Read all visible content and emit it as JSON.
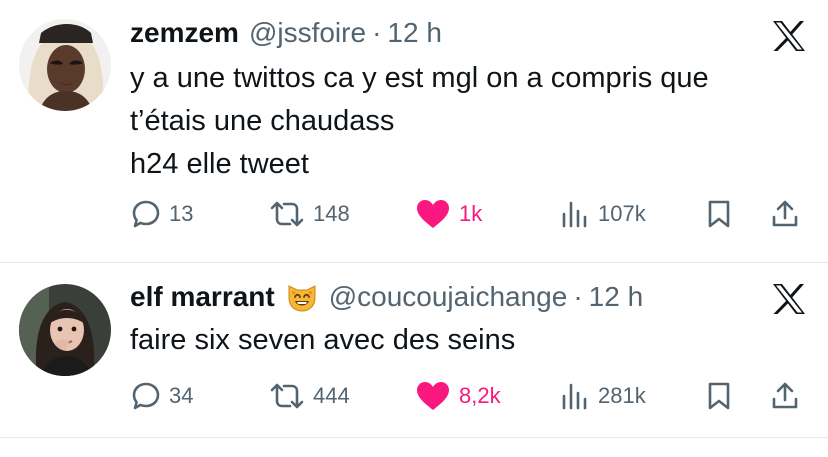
{
  "colors": {
    "like": "#f91880",
    "muted": "#536471",
    "text": "#0f1419"
  },
  "tweets": [
    {
      "name": "zemzem",
      "handle": "@jssfoire",
      "separator": "·",
      "time": "12 h",
      "body": [
        "y a une twittos ca y est mgl on a compris que",
        "t’étais une chaudass",
        "h24 elle tweet"
      ],
      "replies": "13",
      "retweets": "148",
      "likes": "1k",
      "views": "107k",
      "liked": true
    },
    {
      "name": "elf marrant",
      "emoji": "smiling-cat-emoji",
      "handle": "@coucoujaichange",
      "separator": "·",
      "time": "12 h",
      "body": [
        "faire six seven avec des seins"
      ],
      "replies": "34",
      "retweets": "444",
      "likes": "8,2k",
      "views": "281k",
      "liked": true
    }
  ],
  "icons": [
    "x-logo-icon",
    "reply-icon",
    "retweet-icon",
    "heart-icon",
    "views-icon",
    "bookmark-icon",
    "share-icon"
  ]
}
